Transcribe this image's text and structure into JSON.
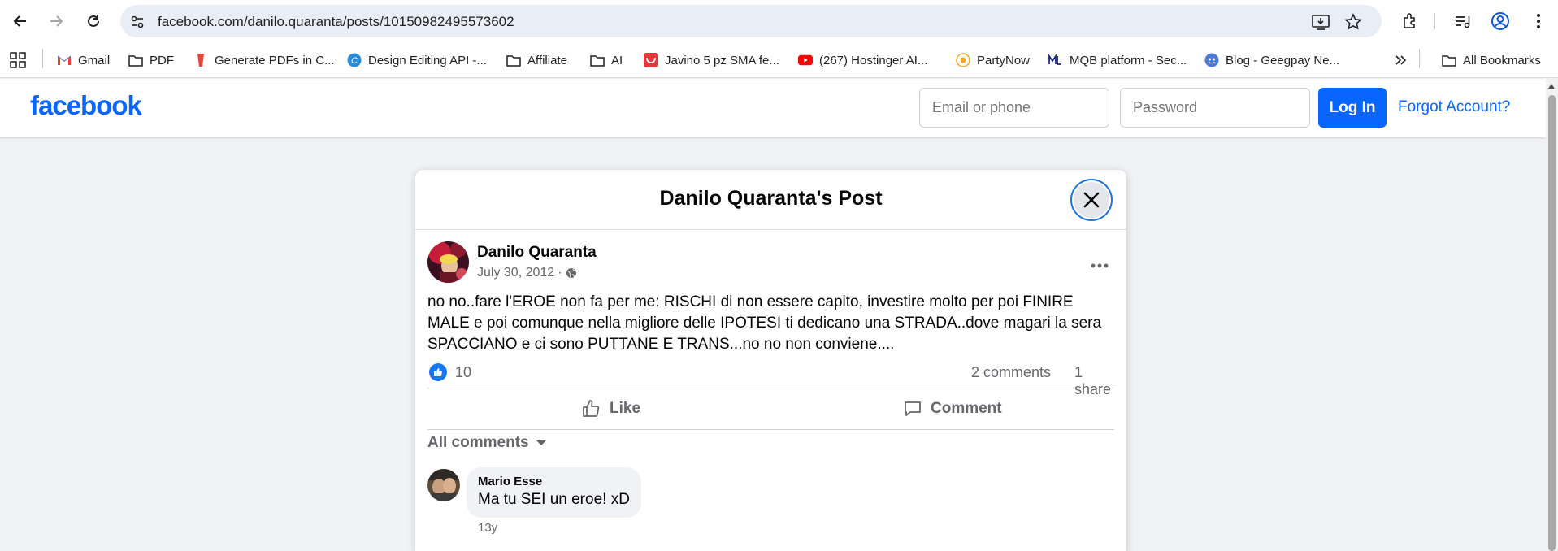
{
  "browser": {
    "url": "facebook.com/danilo.quaranta/posts/10150982495573602",
    "bookmarks": [
      {
        "label": "Gmail",
        "icon": "gmail-icon"
      },
      {
        "label": "PDF",
        "icon": "folder-icon"
      },
      {
        "label": "Generate PDFs in C...",
        "icon": "pdf-app-icon"
      },
      {
        "label": "Design Editing API -...",
        "icon": "canva-icon"
      },
      {
        "label": "Affiliate",
        "icon": "folder-icon"
      },
      {
        "label": "AI",
        "icon": "folder-icon"
      },
      {
        "label": "Javino 5 pz SMA fe...",
        "icon": "shop-icon"
      },
      {
        "label": "(267) Hostinger AI...",
        "icon": "youtube-icon"
      },
      {
        "label": "PartyNow",
        "icon": "partynow-icon"
      },
      {
        "label": "MQB platform - Sec...",
        "icon": "mqb-icon"
      },
      {
        "label": "Blog - Geegpay Ne...",
        "icon": "geegpay-icon"
      }
    ],
    "all_bookmarks_label": "All Bookmarks",
    "colors": {
      "chrome_bg": "#ffffff",
      "omnibox_bg": "#e9eef6"
    }
  },
  "header": {
    "logo": "facebook",
    "email_placeholder": "Email or phone",
    "password_placeholder": "Password",
    "login_label": "Log In",
    "forgot_label": "Forgot Account?",
    "colors": {
      "brand": "#0866ff"
    }
  },
  "modal": {
    "title": "Danilo Quaranta's Post",
    "post": {
      "author": "Danilo Quaranta",
      "date": "July 30, 2012",
      "separator": "·",
      "audience_icon": "globe-icon",
      "text": "no no..fare l'EROE non fa per me: RISCHI di non essere capito, investire molto per poi FINIRE MALE e poi comunque nella migliore delle IPOTESI ti dedicano una STRADA..dove magari la sera SPACCIANO e ci sono PUTTANE E TRANS...no no non conviene....",
      "like_count": "10",
      "comments_count": "2 comments",
      "shares_count": "1 share"
    },
    "actions": {
      "like_label": "Like",
      "comment_label": "Comment"
    },
    "comments_filter": "All comments",
    "comments": [
      {
        "author": "Mario Esse",
        "text": "Ma tu SEI un eroe! xD",
        "time": "13y"
      }
    ]
  }
}
